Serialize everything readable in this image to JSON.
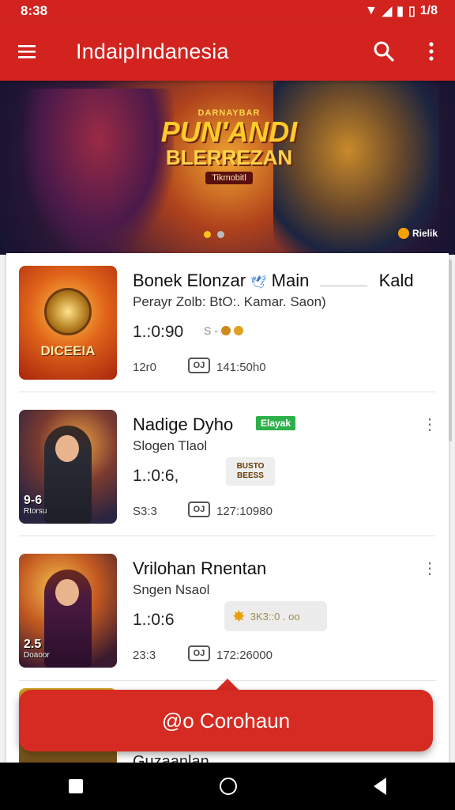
{
  "status_bar": {
    "time": "8:38",
    "battery_text": "1/8"
  },
  "app_bar": {
    "title": "IndaipIndanesia",
    "menu_icon": "menu-icon",
    "search_icon": "search-icon",
    "more_icon": "more-vert-icon"
  },
  "banner": {
    "logo_top": "DARNAYBAR",
    "logo_main": "PUN'ANDI",
    "logo_sub": "BLERREZAN",
    "logo_tag": "Tikmobitl",
    "badge": "Rielik",
    "slides": 2,
    "active_slide": 0
  },
  "items": [
    {
      "name": "Bonek Elonzar",
      "name_extra": "Main",
      "name_tail": "Kald",
      "subtitle": "Perayr Zolb: BtO:. Kamar. Saon)",
      "price": "1.:0:90",
      "price_suffix": "S -",
      "meta_a": "12r0",
      "meta_icon": "OJ",
      "meta_b": "141:50h0",
      "thumb_label": "DICEEIA"
    },
    {
      "name": "Nadige Dyho",
      "tag": "Elayak",
      "subtitle": "Slogen Tlaol",
      "price": "1.:0:6,",
      "promo": "BUSTO BEESS",
      "meta_a": "S3:3",
      "meta_icon": "OJ",
      "meta_b": "127:10980",
      "corner_big": "9-6",
      "corner_small": "Rtorsu"
    },
    {
      "name": "Vrilohan Rnentan",
      "subtitle": "Sngen Nsaol",
      "price": "1.:0:6",
      "stars_text": "3K3::0 . oo",
      "meta_a": "23:3",
      "meta_icon": "OJ",
      "meta_b": "172:26000",
      "corner_big": "2.5",
      "corner_small": "Doaoor"
    }
  ],
  "fab": {
    "label": "@o Corohaun"
  },
  "peek_item": {
    "name": "Guzaanlan"
  }
}
